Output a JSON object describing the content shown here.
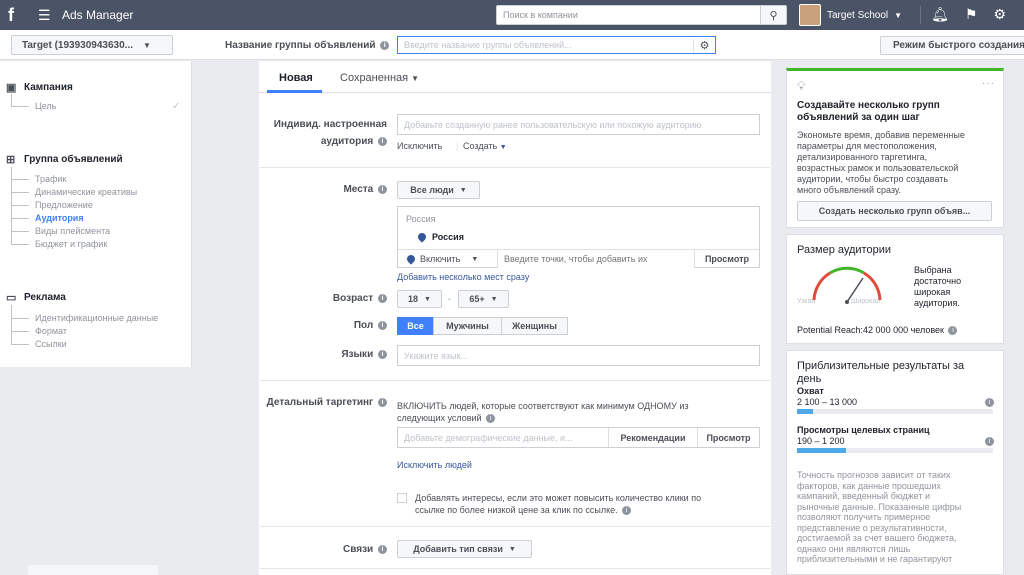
{
  "topbar": {
    "logo": "f",
    "app_title": "Ads Manager",
    "search_placeholder": "Поиск в компании",
    "account_name": "Target School"
  },
  "subbar": {
    "campaign_select": "Target (193930943630...",
    "adset_name_label": "Название группы объявлений",
    "adset_name_placeholder": "Введите название группы объявлений...",
    "quick_mode": "Режим быстрого создания"
  },
  "sidebar": {
    "campaign": {
      "label": "Кампания",
      "items": [
        "Цель"
      ]
    },
    "adset": {
      "label": "Группа объявлений",
      "items": [
        "Трафик",
        "Динамические креативы",
        "Предложение",
        "Аудитория",
        "Виды плейсмента",
        "Бюджет и график"
      ],
      "active": "Аудитория"
    },
    "ad": {
      "label": "Реклама",
      "items": [
        "Идентификационные данные",
        "Формат",
        "Ссылки"
      ]
    }
  },
  "tabs": {
    "new": "Новая",
    "saved": "Сохраненная"
  },
  "form": {
    "custom_audience": {
      "label_line1": "Индивид. настроенная",
      "label_line2": "аудитория",
      "placeholder": "Добавьте созданную ранее пользовательскую или похожую аудиторию",
      "exclude": "Исключить",
      "create": "Создать"
    },
    "places": {
      "label": "Места",
      "dropdown": "Все люди",
      "country_header": "Россия",
      "country": "Россия",
      "include": "Включить",
      "placeholder": "Введите точки, чтобы добавить их",
      "browse": "Просмотр",
      "add_multiple": "Добавить несколько мест сразу"
    },
    "age": {
      "label": "Возраст",
      "from": "18",
      "to": "65+",
      "dash": "-"
    },
    "gender": {
      "label": "Пол",
      "options": [
        "Все",
        "Мужчины",
        "Женщины"
      ]
    },
    "languages": {
      "label": "Языки",
      "placeholder": "Укажите язык..."
    },
    "detailed": {
      "label": "Детальный таргетинг",
      "desc_line1": "ВКЛЮЧИТЬ людей, которые соответствуют как минимум ОДНОМУ из",
      "desc_line2": "следующих условий",
      "placeholder": "Добавьте демографические данные, и...",
      "recommendations": "Рекомендации",
      "browse": "Просмотр",
      "exclude_people": "Исключить людей",
      "expand_line1": "Добавлять интересы, если это может повысить количество клики по",
      "expand_line2": "ссылке по более низкой цене за клик по ссылке."
    },
    "connections": {
      "label": "Связи",
      "button": "Добавить тип связи"
    }
  },
  "right": {
    "tip": {
      "title_line1": "Создавайте несколько групп",
      "title_line2": "объявлений за один шаг",
      "body": [
        "Экономьте время, добавив переменные",
        "параметры для местоположения,",
        "детализированного таргетинга,",
        "возрастных рамок и пользовательской",
        "аудитории, чтобы быстро создавать",
        "много объявлений сразу."
      ],
      "button": "Создать несколько групп объяв..."
    },
    "audience_size": {
      "title": "Размер аудитории",
      "desc": [
        "Выбрана",
        "достаточно",
        "широкая",
        "аудитория."
      ],
      "narrow": "Узкая",
      "broad": "Широкая",
      "reach": "Potential Reach:42 000 000 человек"
    },
    "estimates": {
      "title_line1": "Приблизительные результаты за",
      "title_line2": "день",
      "reach_label": "Охват",
      "reach_value": "2 100 – 13 000",
      "reach_fill": 0.08,
      "views_label": "Просмотры целевых страниц",
      "views_value": "190 – 1 200",
      "views_fill": 0.25,
      "note": [
        "Точность прогнозов зависит от таких",
        "факторов, как данные прошедших",
        "кампаний, введенный бюджет и",
        "рыночные данные. Показанные цифры",
        "позволяют получить примерное",
        "представление о результативности,",
        "достигаемой за счет вашего бюджета,",
        "однако они являются лишь",
        "приблизительными и не гарантируют"
      ]
    }
  }
}
